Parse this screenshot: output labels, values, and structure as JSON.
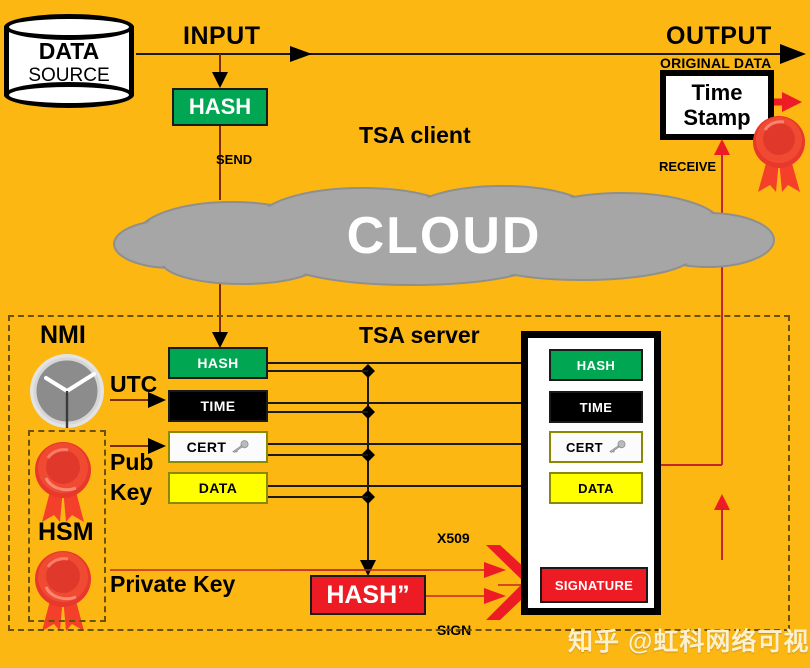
{
  "theme": {
    "background": "#FCB713",
    "green": "#00A651",
    "red": "#ED1C24",
    "yellow": "#FFFF00",
    "black": "#000000",
    "white": "#FFFFFF",
    "cloud_gray": "#A6A6A6",
    "dash_border": "#6B5200",
    "line_dark": "#1A1A1A",
    "line_red": "#C1272D"
  },
  "title_labels": {
    "input": "INPUT",
    "output": "OUTPUT",
    "original_data": "ORIGINAL DATA",
    "send": "SEND",
    "receive": "RECEIVE",
    "tsa_client": "TSA client",
    "tsa_server": "TSA server"
  },
  "data_source": {
    "line1": "DATA",
    "line2": "SOURCE"
  },
  "client": {
    "hash_box": "HASH",
    "timestamp_line1": "Time",
    "timestamp_line2": "Stamp"
  },
  "cloud": {
    "label": "CLOUD"
  },
  "nmi": {
    "label": "NMI",
    "clock_icon": "clock-icon",
    "utc_label": "UTC"
  },
  "hsm": {
    "label": "HSM",
    "pub_key_label_line1": "Pub",
    "pub_key_label_line2": "Key",
    "private_key_label": "Private Key",
    "seal_icon": "wax-seal-icon"
  },
  "server_inputs": [
    {
      "label": "HASH",
      "id": "hash"
    },
    {
      "label": "TIME",
      "id": "time"
    },
    {
      "label": "CERT",
      "id": "cert",
      "icon": "key-icon"
    },
    {
      "label": "DATA",
      "id": "data"
    }
  ],
  "server_panel": [
    {
      "label": "HASH",
      "id": "hash"
    },
    {
      "label": "TIME",
      "id": "time"
    },
    {
      "label": "CERT",
      "id": "cert",
      "icon": "key-icon"
    },
    {
      "label": "DATA",
      "id": "data"
    },
    {
      "label": "SIGNATURE",
      "id": "signature"
    }
  ],
  "signing": {
    "hash2_label": "HASH”",
    "x509_label": "X509",
    "sign_label": "SIGN",
    "chevron_icon": "chevron-right-icon"
  },
  "watermark": {
    "text": "知乎 @虹科网络可视化与..."
  }
}
